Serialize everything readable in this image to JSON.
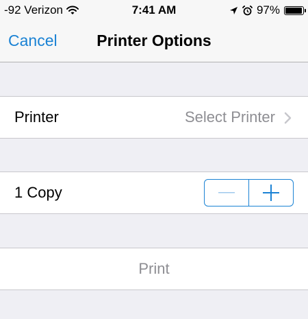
{
  "status_bar": {
    "carrier": "-92 Verizon",
    "time": "7:41 AM",
    "battery_percent": "97%",
    "battery_level": 0.97,
    "icons": [
      "wifi-icon",
      "location-arrow-icon",
      "alarm-clock-icon",
      "battery-icon"
    ]
  },
  "nav": {
    "cancel_label": "Cancel",
    "title": "Printer Options"
  },
  "printer_row": {
    "label": "Printer",
    "value": "Select Printer",
    "icon": "chevron-right-icon"
  },
  "copies_row": {
    "label": "1 Copy",
    "decrement_icon": "minus-icon",
    "increment_icon": "plus-icon"
  },
  "print_row": {
    "label": "Print"
  },
  "colors": {
    "accent": "#1a82d4",
    "background": "#efeff4",
    "secondary_text": "#8e8e93",
    "separator": "#c8c7cc"
  }
}
